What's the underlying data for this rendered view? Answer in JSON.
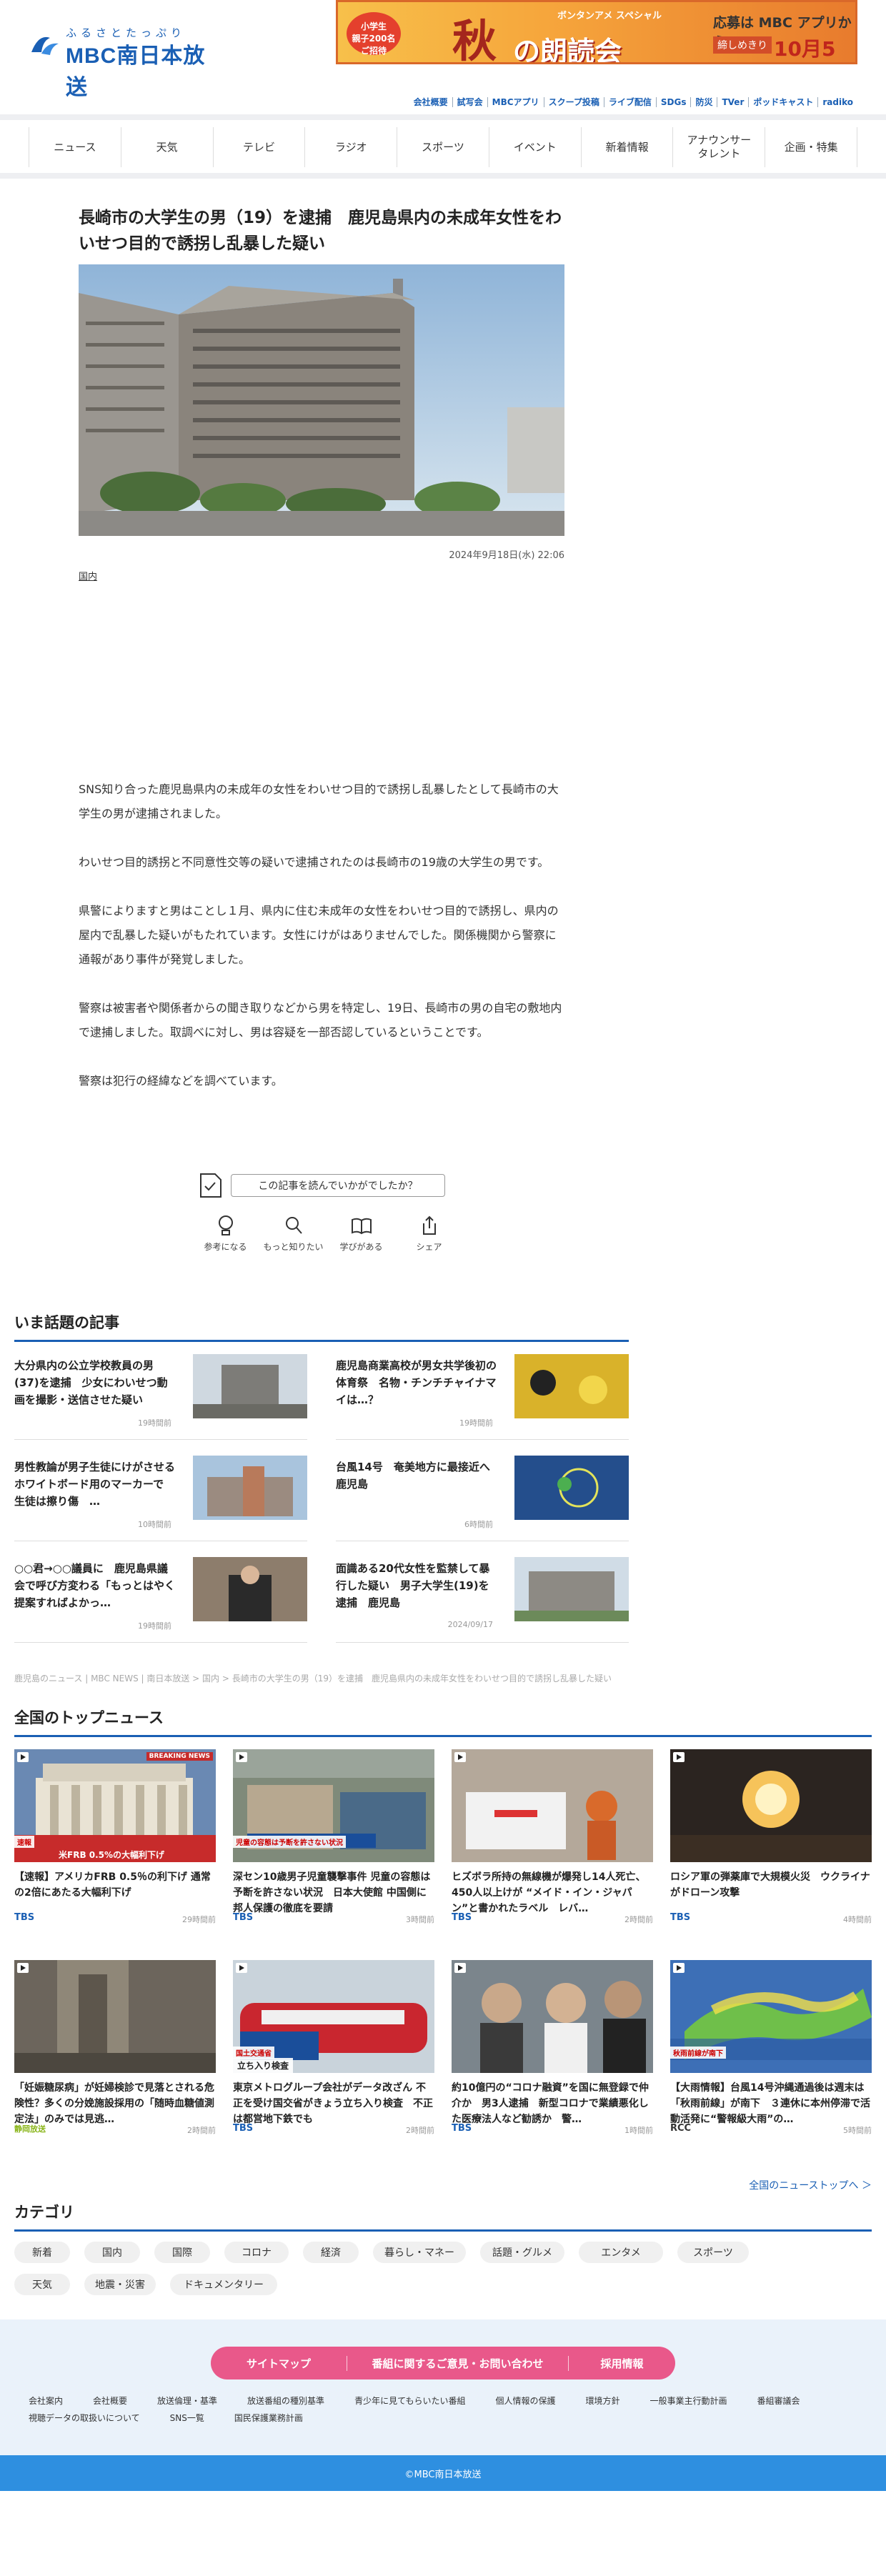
{
  "header": {
    "logo_kana": "ふるさとたっぷり",
    "logo_text": "MBC南日本放送",
    "banner": {
      "badge": "小学生\n親子200名\nご招待",
      "big_char": "秋",
      "sub": "ボンタンアメ スペシャル",
      "title": "の朗読会",
      "apply": "応募は MBC アプリから",
      "deadline_label": "締しめきり",
      "deadline": "10月5日(土)"
    },
    "top_links": [
      "会社概要",
      "試写会",
      "MBCアプリ",
      "スクープ投稿",
      "ライブ配信",
      "SDGs",
      "防災",
      "TVer",
      "ポッドキャスト",
      "radiko"
    ]
  },
  "nav": [
    "ニュース",
    "天気",
    "テレビ",
    "ラジオ",
    "スポーツ",
    "イベント",
    "新着情報",
    "アナウンサー\nタレント",
    "企画・特集"
  ],
  "article": {
    "title": "長崎市の大学生の男（19）を逮捕　鹿児島県内の未成年女性をわいせつ目的で誘拐し乱暴した疑い",
    "date": "2024年9月18日(水) 22:06",
    "category": "国内",
    "paragraphs": [
      "SNS知り合った鹿児島県内の未成年の女性をわいせつ目的で誘拐し乱暴したとして長崎市の大学生の男が逮捕されました。",
      "わいせつ目的誘拐と不同意性交等の疑いで逮捕されたのは長崎市の19歳の大学生の男です。",
      "県警によりますと男はことし１月、県内に住む未成年の女性をわいせつ目的で誘拐し、県内の屋内で乱暴した疑いがもたれています。女性にけがはありませんでした。関係機関から警察に通報があり事件が発覚しました。",
      "警察は被害者や関係者からの聞き取りなどから男を特定し、19日、長崎市の男の自宅の敷地内で逮捕しました。取調べに対し、男は容疑を一部否認しているということです。",
      "警察は犯行の経緯などを調べています。"
    ],
    "survey_label": "この記事を読んでいかがでしたか？",
    "reactions": [
      "参考になる",
      "もっと知りたい",
      "学びがある",
      "シェア"
    ]
  },
  "hot": {
    "heading": "いま話題の記事",
    "items": [
      {
        "title": "大分県内の公立学校教員の男(37)を逮捕　少女にわいせつ動画を撮影・送信させた疑い",
        "time": "19時間前"
      },
      {
        "title": "鹿児島商業高校が男女共学後初の体育祭　名物・チンチチャイナマイは…？",
        "time": "19時間前"
      },
      {
        "title": "男性教論が男子生徒にけがさせる　ホワイトボード用のマーカーで　生徒は擦り傷　…",
        "time": "10時間前"
      },
      {
        "title": "台風14号　奄美地方に最接近へ　鹿児島",
        "time": "6時間前"
      },
      {
        "title": "○○君→○○議員に　鹿児島県議会で呼び方変わる「もっとはやく提案すればよかっ…",
        "time": "19時間前"
      },
      {
        "title": "面識ある20代女性を監禁して暴行した疑い　男子大学生(19)を逮捕　鹿児島",
        "time": "2024/09/17"
      }
    ]
  },
  "breadcrumb": "鹿児島のニュース | MBC NEWS | 南日本放送 > 国内 > 長崎市の大学生の男（19）を逮捕　鹿児島県内の未成年女性をわいせつ目的で誘拐し乱暴した疑い",
  "national": {
    "heading": "全国のトップニュース",
    "items": [
      {
        "title": "【速報】アメリカFRB 0.5％の利下げ 通常の2倍にあたる大幅利下げ",
        "source": "TBS",
        "time": "29時間前",
        "overlay1": "速報",
        "overlay2": "米FRB 0.5%の大幅利下げ",
        "tag": "BREAKING NEWS"
      },
      {
        "title": "深セン10歳男子児童襲撃事件 児童の容態は予断を許さない状況　日本大使館 中国側に邦人保護の徹底を要請",
        "source": "TBS",
        "time": "3時間前",
        "overlay1": "児童の容態は予断を許さない状況",
        "overlay2": "",
        "tag": ""
      },
      {
        "title": "ヒズボラ所持の無線機が爆発し14人死亡、450人以上けが “メイド・イン・ジャパン”と書かれたラベル　レバ…",
        "source": "TBS",
        "time": "2時間前",
        "overlay1": "",
        "overlay2": "",
        "tag": ""
      },
      {
        "title": "ロシア軍の弾薬庫で大規模火災　ウクライナがドローン攻撃",
        "source": "TBS",
        "time": "4時間前",
        "overlay1": "",
        "overlay2": "",
        "tag": ""
      },
      {
        "title": "「妊娠糖尿病」が妊婦検診で見落とされる危険性？多くの分娩施設採用の「随時血糖値測定法」のみでは見逃…",
        "source": "静岡放送",
        "time": "2時間前",
        "overlay1": "",
        "overlay2": "",
        "tag": ""
      },
      {
        "title": "東京メトログループ会社がデータ改ざん 不正を受け国交省がきょう立ち入り検査　不正は都営地下鉄でも",
        "source": "TBS",
        "time": "2時間前",
        "overlay1": "国土交通省",
        "overlay2": "立ち入り検査",
        "tag": ""
      },
      {
        "title": "約10億円の“コロナ融資”を国に無登録で仲介か　男3人逮捕　新型コロナで業績悪化した医療法人など勧誘か　警…",
        "source": "TBS",
        "time": "1時間前",
        "overlay1": "",
        "overlay2": "",
        "tag": ""
      },
      {
        "title": "【大雨情報】台風14号沖縄通過後は週末は「秋雨前線」が南下　３連休に本州停滞で活動活発に“警報級大雨”の…",
        "source": "RCC",
        "time": "5時間前",
        "overlay1": "秋雨前線が南下",
        "overlay2": "",
        "tag": ""
      }
    ],
    "more": "全国のニューストップへ ＞"
  },
  "categories": {
    "heading": "カテゴリ",
    "items": [
      "新着",
      "国内",
      "国際",
      "コロナ",
      "経済",
      "暮らし・マネー",
      "話題・グルメ",
      "エンタメ",
      "スポーツ",
      "天気",
      "地震・災害",
      "ドキュメンタリー"
    ]
  },
  "footer": {
    "buttons": [
      "サイトマップ",
      "番組に関するご意見・お問い合わせ",
      "採用情報"
    ],
    "links": [
      "会社案内",
      "会社概要",
      "放送倫理・基準",
      "放送番組の種別基準",
      "青少年に見てもらいたい番組",
      "個人情報の保護",
      "環境方針",
      "一般事業主行動計画",
      "番組審議会",
      "視聴データの取扱いについて",
      "SNS一覧",
      "国民保護業務計画"
    ],
    "copyright": "©MBC南日本放送"
  },
  "colors": {
    "brand": "#1a5fb4",
    "footer_btn": "#e9588a",
    "copyright_bar": "#2e8fe0"
  }
}
